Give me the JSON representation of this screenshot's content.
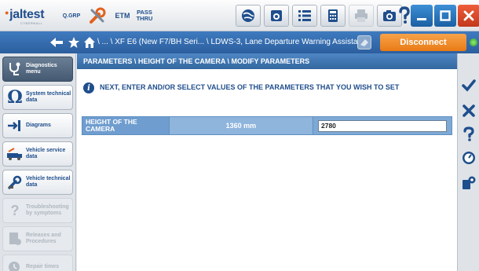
{
  "app": {
    "logo_text": "jaltest",
    "logo_sub": "CYBERNALL"
  },
  "toolbar": {
    "quick_group_label": "Q.GRP",
    "etm_label": "ETM",
    "pass_thru_line1": "PASS",
    "pass_thru_line2": "THRU",
    "icons": [
      "wrench-screwdriver-icon",
      "globe-icon",
      "camera-settings-icon",
      "list-icon",
      "calculator-icon",
      "printer-icon",
      "camera-icon",
      "help-icon"
    ]
  },
  "navbar": {
    "breadcrumb": "\\ ... \\ XF E6 (New F7/BH Seri... \\ LDWS-3, Lane Departure Warning Assistant",
    "disconnect_label": "Disconnect",
    "status_color": "#3fbf2a"
  },
  "sidebar": {
    "items": [
      {
        "label": "Diagnostics menu",
        "icon": "stethoscope-icon",
        "state": "active"
      },
      {
        "label": "System technical data",
        "icon": "omega-icon",
        "state": "enabled"
      },
      {
        "label": "Diagrams",
        "icon": "diagram-arrow-icon",
        "state": "enabled"
      },
      {
        "label": "Vehicle service data",
        "icon": "truck-wrench-icon",
        "state": "enabled"
      },
      {
        "label": "Vehicle technical data",
        "icon": "wrench-icon",
        "state": "enabled"
      },
      {
        "label": "Troubleshooting by symptoms",
        "icon": "question-wrench-icon",
        "state": "disabled"
      },
      {
        "label": "Releases and Procedures",
        "icon": "document-gear-icon",
        "state": "disabled"
      },
      {
        "label": "Repair times",
        "icon": "clock-wrench-icon",
        "state": "disabled"
      }
    ]
  },
  "main": {
    "path": "PARAMETERS \\ HEIGHT OF THE CAMERA \\ MODIFY PARAMETERS",
    "instruction": "NEXT, ENTER AND/OR SELECT VALUES OF THE PARAMETERS THAT YOU WISH TO SET",
    "parameter": {
      "name": "HEIGHT OF THE CAMERA",
      "current_value": "1360 mm",
      "new_value": "2780"
    }
  },
  "rightbar": {
    "icons": [
      "checkmark-icon",
      "cancel-icon",
      "help-icon",
      "gauge-icon",
      "settings-icon"
    ]
  },
  "colors": {
    "brand_blue": "#1f4e8c",
    "nav_blue": "#3f7bbf",
    "disconnect_orange": "#e97b15",
    "close_red": "#d9431f"
  }
}
